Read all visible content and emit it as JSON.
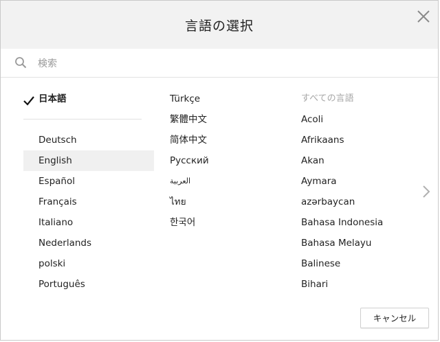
{
  "dialog": {
    "title": "言語の選択",
    "search_placeholder": "検索",
    "cancel_label": "キャンセル"
  },
  "column1": {
    "selected": "日本語",
    "items": [
      "Deutsch",
      "English",
      "Español",
      "Français",
      "Italiano",
      "Nederlands",
      "polski",
      "Português"
    ],
    "highlighted_index": 1
  },
  "column2": {
    "items": [
      "Türkçe",
      "繁體中文",
      "简体中文",
      "Русский",
      "العربية",
      "ไทย",
      "한국어"
    ]
  },
  "column3": {
    "heading": "すべての言語",
    "items": [
      "Acoli",
      "Afrikaans",
      "Akan",
      "Aymara",
      "azərbaycan",
      "Bahasa Indonesia",
      "Bahasa Melayu",
      "Balinese",
      "Bihari"
    ]
  },
  "icons": {
    "close": "close-icon",
    "search": "search-icon",
    "check": "checkmark-icon",
    "next": "chevron-right-icon"
  }
}
